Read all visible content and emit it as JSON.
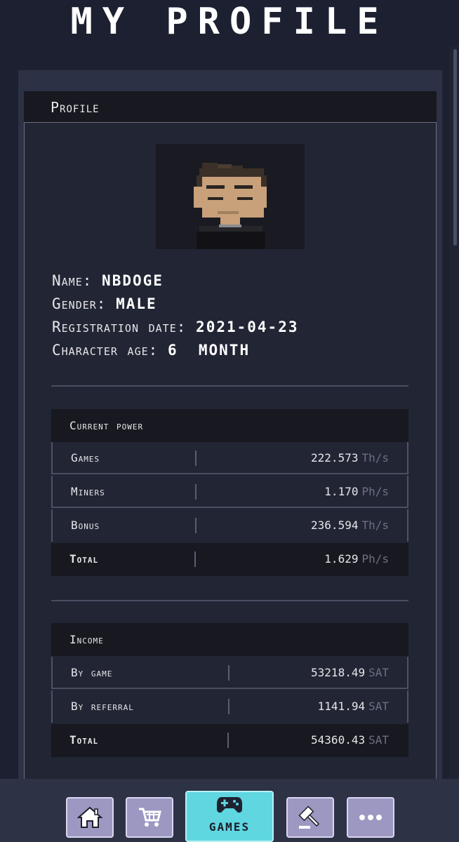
{
  "page": {
    "title": "My Profile"
  },
  "profile": {
    "section_title": "Profile",
    "name_label": "Name:",
    "name_value": "NBDOGE",
    "gender_label": "Gender:",
    "gender_value": "male",
    "registration_label": "Registration date:",
    "registration_value": "2021-04-23",
    "age_label": "Character age:",
    "age_value": "6  month"
  },
  "power": {
    "title": "Current power",
    "rows": [
      {
        "label": "Games",
        "value": "222.573",
        "unit": "Th/s"
      },
      {
        "label": "Miners",
        "value": "1.170",
        "unit": "Ph/s"
      },
      {
        "label": "Bonus",
        "value": "236.594",
        "unit": "Th/s"
      }
    ],
    "total": {
      "label": "Total",
      "value": "1.629",
      "unit": "Ph/s"
    }
  },
  "income": {
    "title": "Income",
    "rows": [
      {
        "label": "By game",
        "value": "53218.49",
        "unit": "SAT"
      },
      {
        "label": "By referral",
        "value": "1141.94",
        "unit": "SAT"
      }
    ],
    "total": {
      "label": "Total",
      "value": "54360.43",
      "unit": "SAT"
    }
  },
  "nav": {
    "items": [
      {
        "icon": "home-icon"
      },
      {
        "icon": "cart-icon"
      },
      {
        "icon": "gamepad-icon",
        "label": "Games",
        "active": true
      },
      {
        "icon": "auction-hammer-icon"
      },
      {
        "icon": "more-icon"
      }
    ]
  },
  "colors": {
    "background": "#1c2030",
    "panel": "#222534",
    "header_bar": "#181820",
    "nav_button": "#9c98c2",
    "nav_active": "#5fd6e0",
    "unit_text": "#6d7085"
  }
}
